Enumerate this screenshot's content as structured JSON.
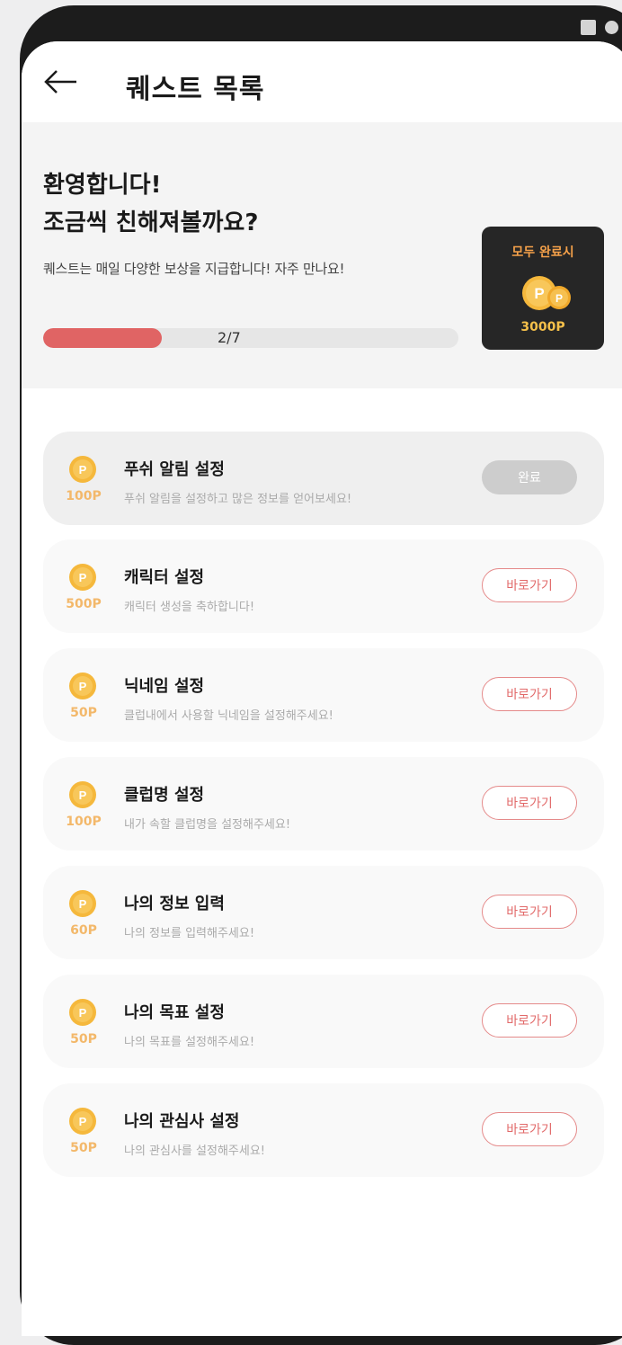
{
  "header": {
    "title": "퀘스트 목록"
  },
  "hero": {
    "title_line1": "환영합니다!",
    "title_line2": "조금씩 친해져볼까요?",
    "description": "퀘스트는 매일 다양한 보상을 지급합니다! 자주 만나요!",
    "progress_text": "2/7",
    "progress_fraction": 0.2857
  },
  "reward": {
    "title": "모두 완료시",
    "amount": "3000P"
  },
  "quests": [
    {
      "points": "100P",
      "title": "푸쉬 알림 설정",
      "description": "푸쉬 알림을 설정하고 많은 정보를 얻어보세요!",
      "button": "완료",
      "done": true
    },
    {
      "points": "500P",
      "title": "캐릭터 설정",
      "description": "캐릭터 생성을 축하합니다!",
      "button": "바로가기",
      "done": false
    },
    {
      "points": "50P",
      "title": "닉네임 설정",
      "description": "클럽내에서 사용할 닉네임을 설정해주세요!",
      "button": "바로가기",
      "done": false
    },
    {
      "points": "100P",
      "title": "클럽명 설정",
      "description": "내가 속할 클럽명을 설정해주세요!",
      "button": "바로가기",
      "done": false
    },
    {
      "points": "60P",
      "title": "나의 정보 입력",
      "description": "나의 정보를 입력해주세요!",
      "button": "바로가기",
      "done": false
    },
    {
      "points": "50P",
      "title": "나의 목표 설정",
      "description": "나의 목표를 설정해주세요!",
      "button": "바로가기",
      "done": false
    },
    {
      "points": "50P",
      "title": "나의 관심사 설정",
      "description": "나의 관심사를 설정해주세요!",
      "button": "바로가기",
      "done": false
    }
  ],
  "colors": {
    "accent": "#e26a6a",
    "progress": "#e06464",
    "coin": "#f5b83c",
    "reward_title": "#f5a14a"
  }
}
